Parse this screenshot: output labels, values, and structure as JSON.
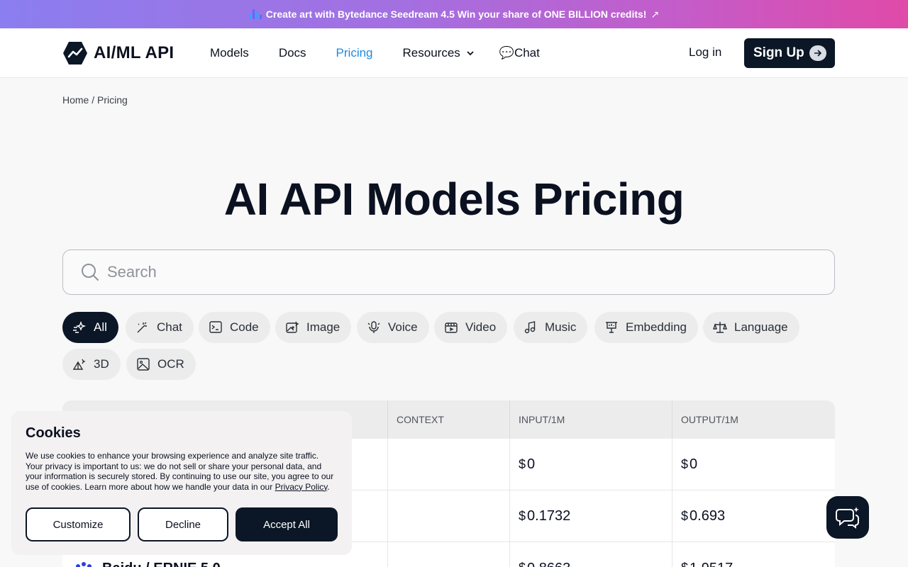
{
  "promo": {
    "text": "Create art with Bytedance Seedream 4.5 Win your share of ONE BILLION credits!",
    "arrow": "↗"
  },
  "header": {
    "logo_text": "AI/ML API",
    "nav": [
      {
        "label": "Models"
      },
      {
        "label": "Docs"
      },
      {
        "label": "Pricing",
        "active": true
      },
      {
        "label": "Resources"
      },
      {
        "label": "💬Chat"
      }
    ],
    "login": "Log in",
    "signup": "Sign Up"
  },
  "breadcrumb": "Home / Pricing",
  "page_title": "AI API Models Pricing",
  "search": {
    "placeholder": "Search",
    "value": ""
  },
  "filters": [
    {
      "label": "All",
      "icon": "sparkles-icon",
      "active": true
    },
    {
      "label": "Chat",
      "icon": "wand-icon"
    },
    {
      "label": "Code",
      "icon": "terminal-icon"
    },
    {
      "label": "Image",
      "icon": "image-icon"
    },
    {
      "label": "Voice",
      "icon": "microphone-icon"
    },
    {
      "label": "Video",
      "icon": "video-icon"
    },
    {
      "label": "Music",
      "icon": "music-icon"
    },
    {
      "label": "Embedding",
      "icon": "embedding-icon"
    },
    {
      "label": "Language",
      "icon": "language-icon"
    },
    {
      "label": "3D",
      "icon": "cube-icon"
    },
    {
      "label": "OCR",
      "icon": "scan-icon"
    }
  ],
  "table": {
    "columns": [
      "CONTEXT",
      "INPUT/1M",
      "OUTPUT/1M"
    ],
    "currency": "$",
    "rows": [
      {
        "input": "0",
        "output": "0"
      },
      {
        "input": "0.1732",
        "output": "0.693"
      },
      {
        "name": "Baidu / ERNIE 5.0",
        "input": "0.8663",
        "output": "1.9517"
      }
    ]
  },
  "cookies": {
    "title": "Cookies",
    "text": "We use cookies to enhance your browsing experience and analyze site traffic. Your privacy is important to us: we do not sell or share your personal data, and your information is securely stored. By continuing to use our site, you agree to our use of cookies. Learn more about how we handle your data in our ",
    "link": "Privacy Policy",
    "customize": "Customize",
    "decline": "Decline",
    "accept": "Accept All"
  },
  "colors": {
    "accent": "#1f8ae0",
    "dark": "#0b1626"
  }
}
